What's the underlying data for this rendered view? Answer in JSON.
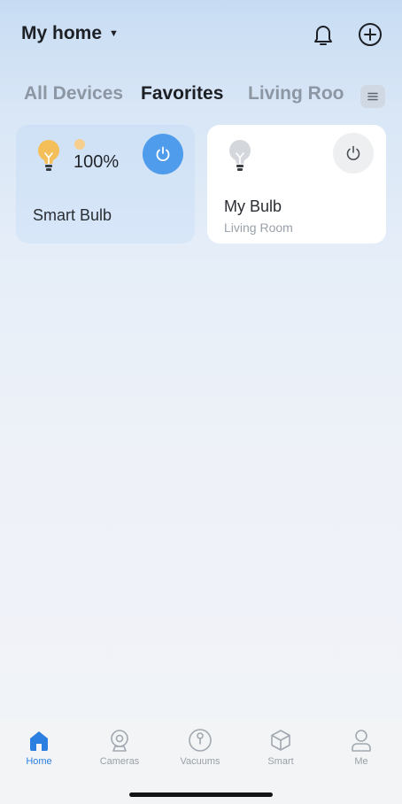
{
  "header": {
    "title": "My home",
    "caret_icon": "caret-down-icon",
    "bell_icon": "bell-icon",
    "add_icon": "plus-circle-icon"
  },
  "tabs": [
    {
      "label": "All Devices",
      "active": false
    },
    {
      "label": "Favorites",
      "active": true
    },
    {
      "label": "Living Roor",
      "active": false
    }
  ],
  "tab_menu_icon": "menu-icon",
  "devices": [
    {
      "name": "Smart Bulb",
      "brightness": "100%",
      "power": "on",
      "icon": "bulb-on-icon",
      "state_color": "#4e9ceb"
    },
    {
      "name": "My Bulb",
      "room": "Living Room",
      "power": "off",
      "icon": "bulb-off-icon"
    }
  ],
  "bottom_nav": [
    {
      "label": "Home",
      "icon": "home-icon",
      "active": true
    },
    {
      "label": "Cameras",
      "icon": "camera-icon",
      "active": false
    },
    {
      "label": "Vacuums",
      "icon": "vacuum-icon",
      "active": false
    },
    {
      "label": "Smart",
      "icon": "cube-icon",
      "active": false
    },
    {
      "label": "Me",
      "icon": "person-icon",
      "active": false
    }
  ],
  "colors": {
    "accent": "#2b7fe0",
    "power_on": "#4e9ceb",
    "bulb_on": "#f4bf58",
    "bulb_off": "#cfd2d6"
  }
}
